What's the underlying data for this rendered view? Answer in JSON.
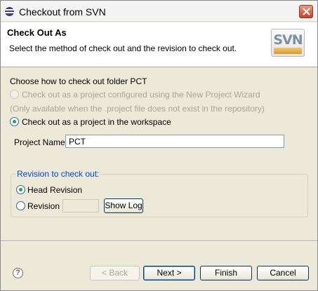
{
  "window": {
    "title": "Checkout from SVN"
  },
  "banner": {
    "title": "Check Out As",
    "description": "Select the method of check out and the revision to check out.",
    "logo_text": "SVN"
  },
  "checkout": {
    "heading": "Choose how to check out folder PCT",
    "option_wizard": "Check out as a project configured using the New Project Wizard",
    "option_wizard_note": "(Only available when the .project file does not exist in the repository)",
    "option_workspace": "Check out as a project in the workspace",
    "project_name_label": "Project Name:",
    "project_name_value": "PCT"
  },
  "revision": {
    "legend": "Revision to check out:",
    "head_label": "Head Revision",
    "revision_label": "Revision",
    "revision_value": "",
    "show_log_label": "Show Log"
  },
  "footer": {
    "help_glyph": "?",
    "back_label": "< Back",
    "next_label": "Next >",
    "finish_label": "Finish",
    "cancel_label": "Cancel"
  },
  "colors": {
    "accent": "#0046d5",
    "radio_selected": "#2fa14a"
  }
}
